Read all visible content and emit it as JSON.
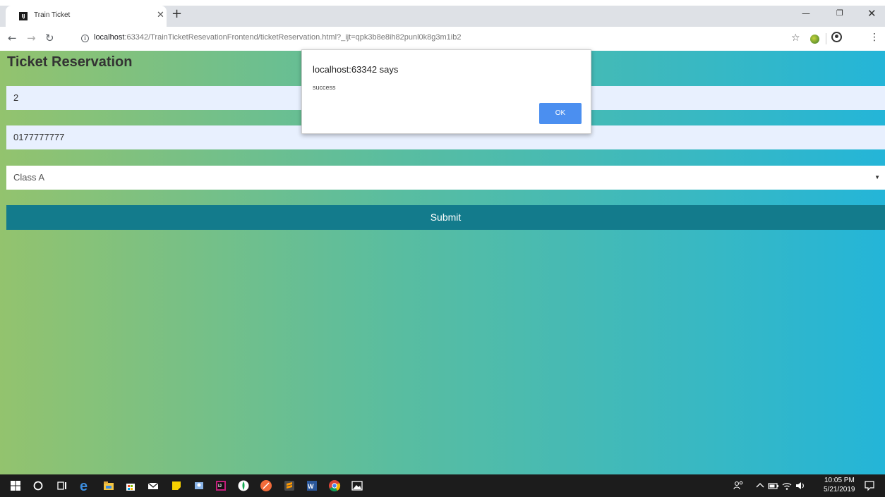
{
  "browser": {
    "tab_title": "Train Ticket",
    "tab_favicon_text": "IJ",
    "url_host": "localhost",
    "url_rest": ":63342/TrainTicketResevationFrontend/ticketReservation.html?_ijt=qpk3b8e8ih82punl0k8g3m1ib2"
  },
  "page": {
    "title": "Ticket Reservation",
    "field_1_value": "2",
    "field_2_value": "0177777777",
    "class_select_value": "Class A",
    "submit_label": "Submit"
  },
  "dialog": {
    "title": "localhost:63342 says",
    "message": "success",
    "ok_label": "OK"
  },
  "taskbar": {
    "time": "10:05 PM",
    "date": "5/21/2019"
  },
  "colors": {
    "gradient_left": "#93c36e",
    "gradient_right": "#24b5d8",
    "submit_bg": "#137b8c",
    "ok_button": "#4b8ff0"
  }
}
